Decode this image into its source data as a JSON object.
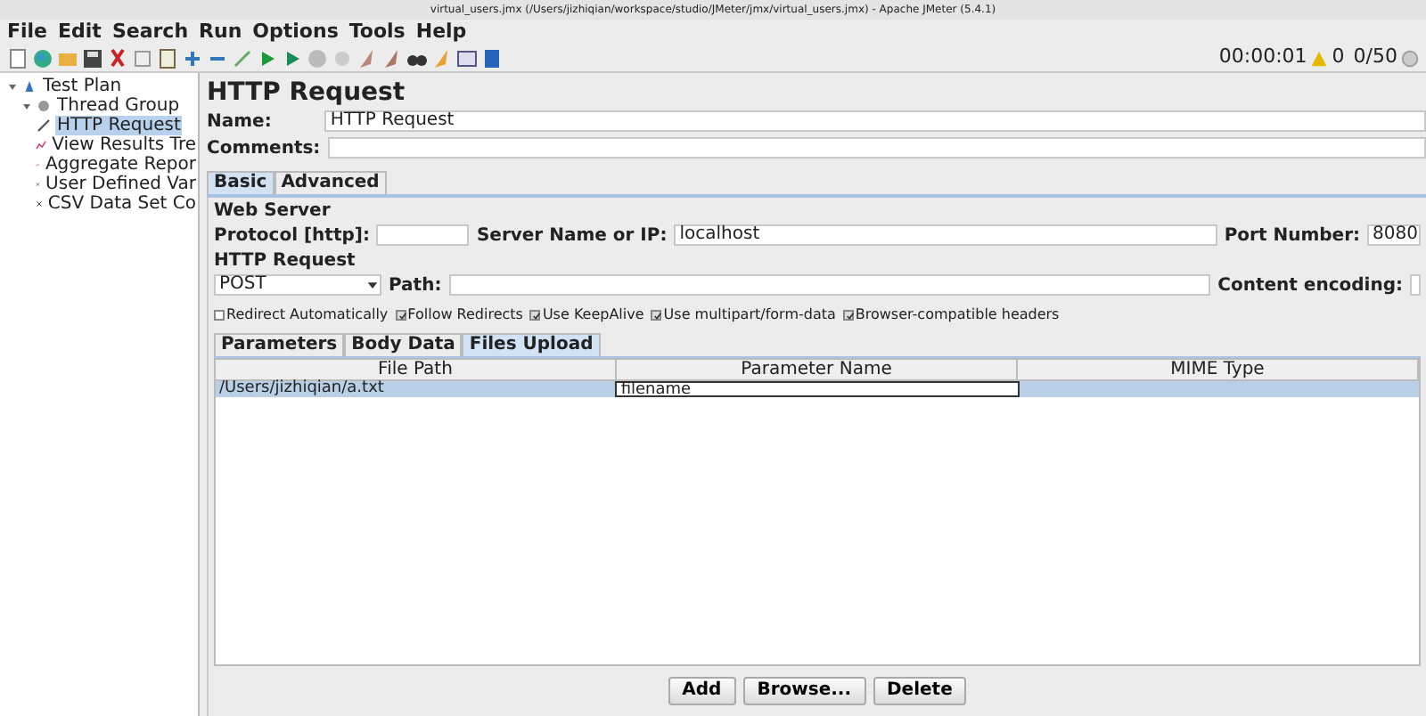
{
  "window": {
    "title": "virtual_users.jmx (/Users/jizhiqian/workspace/studio/JMeter/jmx/virtual_users.jmx) - Apache JMeter (5.4.1)"
  },
  "menu": [
    "File",
    "Edit",
    "Search",
    "Run",
    "Options",
    "Tools",
    "Help"
  ],
  "status": {
    "elapsed": "00:00:01",
    "warnings": "0",
    "threads": "0/50"
  },
  "tree": [
    {
      "label": "Test Plan",
      "kind": "plan",
      "selected": false,
      "children": [
        {
          "label": "Thread Group",
          "kind": "threads",
          "selected": false,
          "children": [
            {
              "label": "HTTP Request",
              "kind": "sampler",
              "selected": true
            },
            {
              "label": "View Results Tre",
              "kind": "listener",
              "selected": false
            },
            {
              "label": "Aggregate Repor",
              "kind": "listener",
              "selected": false
            },
            {
              "label": "User Defined Var",
              "kind": "config",
              "selected": false
            },
            {
              "label": "CSV Data Set Co",
              "kind": "config",
              "selected": false
            }
          ]
        }
      ]
    }
  ],
  "panel": {
    "title": "HTTP Request",
    "name_label": "Name:",
    "name_value": "HTTP Request",
    "comments_label": "Comments:",
    "tabs": [
      {
        "label": "Basic",
        "selected": true
      },
      {
        "label": "Advanced",
        "selected": false
      }
    ],
    "web_server": {
      "title": "Web Server",
      "protocol_label": "Protocol [http]:",
      "server_label": "Server Name or IP:",
      "server_value": "localhost",
      "port_label": "Port Number:",
      "port_value": "8080"
    },
    "http_request": {
      "title": "HTTP Request",
      "method": "POST",
      "path_label": "Path:",
      "encoding_label": "Content encoding:"
    },
    "options": [
      {
        "label": "Redirect Automatically",
        "checked": false
      },
      {
        "label": "Follow Redirects",
        "checked": true
      },
      {
        "label": "Use KeepAlive",
        "checked": true
      },
      {
        "label": "Use multipart/form-data",
        "checked": true
      },
      {
        "label": "Browser-compatible headers",
        "checked": true
      }
    ],
    "subtabs": [
      {
        "label": "Parameters",
        "selected": false
      },
      {
        "label": "Body Data",
        "selected": false
      },
      {
        "label": "Files Upload",
        "selected": true
      }
    ],
    "table": {
      "columns": [
        "File Path",
        "Parameter Name",
        "MIME Type"
      ],
      "rows": [
        {
          "cells": [
            "/Users/jizhiqian/a.txt",
            "filename",
            ""
          ],
          "selected": true
        }
      ]
    },
    "buttons": [
      "Add",
      "Browse...",
      "Delete"
    ]
  }
}
